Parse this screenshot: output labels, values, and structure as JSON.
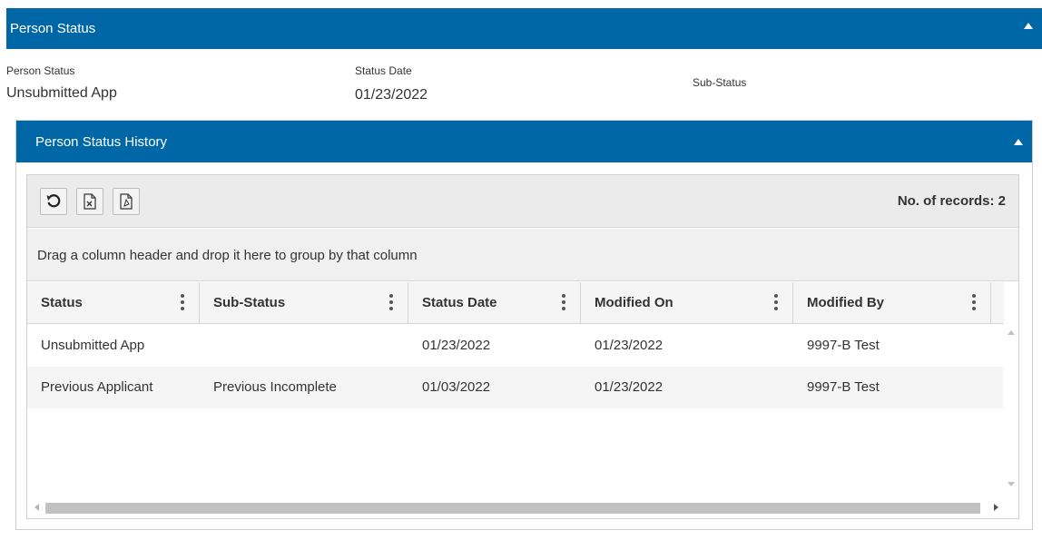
{
  "panel": {
    "title": "Person Status",
    "collapse_icon": "caret-up-icon"
  },
  "fields": {
    "person_status_label": "Person Status",
    "person_status_value": "Unsubmitted App",
    "status_date_label": "Status Date",
    "status_date_value": "01/23/2022",
    "sub_status_label": "Sub-Status"
  },
  "history": {
    "title": "Person Status History",
    "toolbar": {
      "buttons": [
        "refresh-icon",
        "excel-export-icon",
        "pdf-export-icon"
      ],
      "records_text": "No. of records: 2"
    },
    "group_hint": "Drag a column header and drop it here to group by that column",
    "columns": [
      "Status",
      "Sub-Status",
      "Status Date",
      "Modified On",
      "Modified By"
    ],
    "rows": [
      {
        "status": "Unsubmitted App",
        "sub_status": "",
        "status_date": "01/23/2022",
        "modified_on": "01/23/2022",
        "modified_by": "9997-B Test"
      },
      {
        "status": "Previous Applicant",
        "sub_status": "Previous Incomplete",
        "status_date": "01/03/2022",
        "modified_on": "01/23/2022",
        "modified_by": "9997-B Test"
      }
    ]
  },
  "colors": {
    "header_blue": "#0067a6"
  }
}
